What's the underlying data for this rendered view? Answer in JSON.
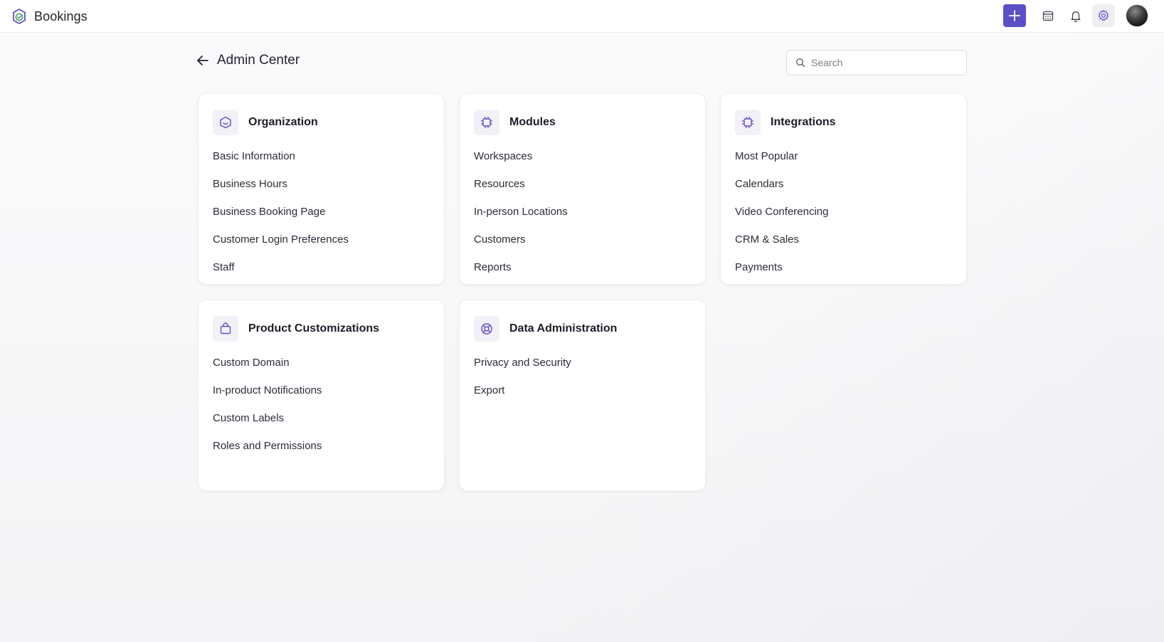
{
  "app": {
    "name": "Bookings"
  },
  "header": {
    "add_icon": "plus-icon",
    "calendar_icon": "calendar-icon",
    "notifications_icon": "bell-icon",
    "settings_icon": "gear-icon",
    "accent": "#5b4fc7"
  },
  "page": {
    "title": "Admin Center",
    "back_icon": "arrow-left-icon"
  },
  "search": {
    "placeholder": "Search"
  },
  "cards": [
    {
      "title": "Organization",
      "icon": "organization-icon",
      "items": [
        "Basic Information",
        "Business Hours",
        "Business Booking Page",
        "Customer Login Preferences",
        "Staff"
      ]
    },
    {
      "title": "Modules",
      "icon": "modules-icon",
      "items": [
        "Workspaces",
        "Resources",
        "In-person Locations",
        "Customers",
        "Reports"
      ]
    },
    {
      "title": "Integrations",
      "icon": "integrations-icon",
      "items": [
        "Most Popular",
        "Calendars",
        "Video Conferencing",
        "CRM & Sales",
        "Payments"
      ]
    },
    {
      "title": "Product Customizations",
      "icon": "shopping-bag-icon",
      "items": [
        "Custom Domain",
        "In-product Notifications",
        "Custom Labels",
        "Roles and Permissions"
      ]
    },
    {
      "title": "Data Administration",
      "icon": "lifebuoy-icon",
      "items": [
        "Privacy and Security",
        "Export"
      ]
    }
  ]
}
